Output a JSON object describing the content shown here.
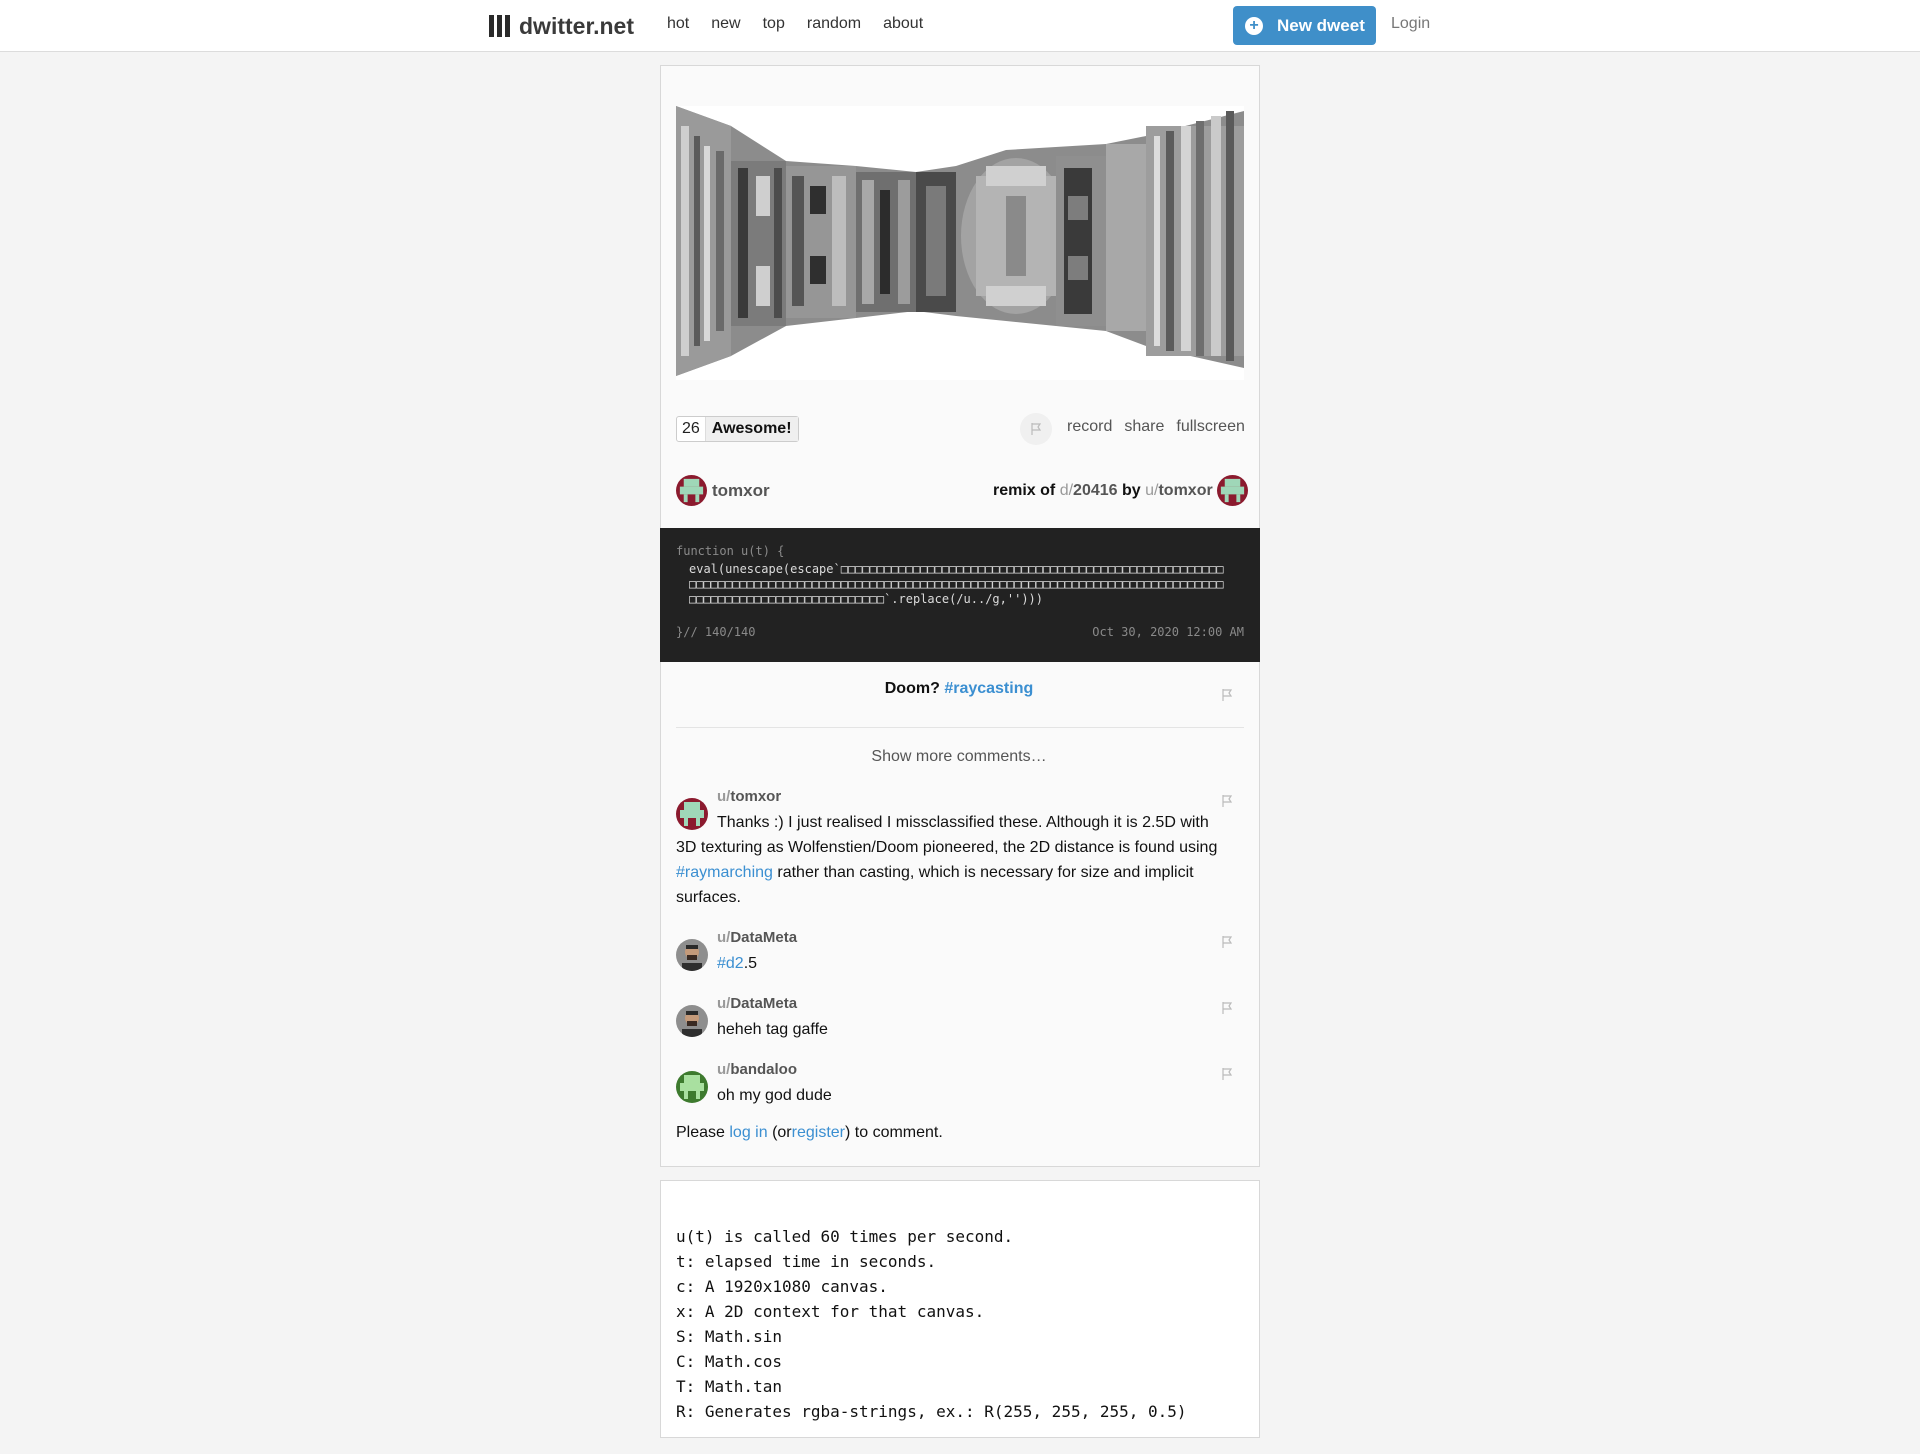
{
  "brand": {
    "name": "dwitter.net"
  },
  "nav": {
    "items": [
      "hot",
      "new",
      "top",
      "random",
      "about"
    ]
  },
  "header": {
    "new_dweet": "New dweet",
    "login": "Login"
  },
  "dweet": {
    "votes": "26",
    "awesome_label": "Awesome!",
    "actions": [
      "record",
      "share",
      "fullscreen"
    ],
    "author": "tomxor",
    "remix_label": "remix of",
    "remix_prefix": "d/",
    "remix_id": "20416",
    "remix_by": "by",
    "remix_user_prefix": "u/",
    "remix_user": "tomxor",
    "code_line1": "function u(t) {",
    "code_body": "eval(unescape(escape`□□□□□□□□□□□□□□□□□□□□□□□□□□□□□□□□□□□□□□□□□□□□□□□□□□□□□□□□□□□□□□□□□□□□□□□□□□□□□□□□□□□□□□□□□□□□□□□□□□□□□□□□□□□□□□□□□□□□□□□□□□□□□□□□□□□□□□□□□□□□□□□□□□□□□□□□□□`.replace(/u../g,'')))",
    "code_end": "}// 140/140",
    "date": "Oct 30, 2020 12:00 AM",
    "description_text": "Doom?",
    "description_tag": "#raycasting"
  },
  "comments": {
    "show_more": "Show more comments…",
    "items": [
      {
        "prefix": "u/",
        "user": "tomxor",
        "text_before": "Thanks :) I just realised I missclassified these. Although it is 2.5D with 3D texturing as Wolfenstien/Doom pioneered, the 2D distance is found using ",
        "tag": "#raymarching",
        "text_after": " rather than casting, which is necessary for size and implicit surfaces."
      },
      {
        "prefix": "u/",
        "user": "DataMeta",
        "tag": "#d2",
        "text_after": ".5"
      },
      {
        "prefix": "u/",
        "user": "DataMeta",
        "text": "heheh tag gaffe"
      },
      {
        "prefix": "u/",
        "user": "bandaloo",
        "text": "oh my god dude"
      }
    ],
    "please": "Please",
    "log_in": "log in",
    "or": "(or",
    "register": "register",
    "to_comment": ") to comment."
  },
  "help": {
    "lines": [
      "u(t) is called 60 times per second.",
      "t: elapsed time in seconds.",
      "c: A 1920x1080 canvas.",
      "x: A 2D context for that canvas.",
      "S: Math.sin",
      "C: Math.cos",
      "T: Math.tan",
      "R: Generates rgba-strings, ex.: R(255, 255, 255, 0.5)"
    ]
  },
  "colors": {
    "accent": "#3f8fc9",
    "link": "#3b8fd1",
    "code_bg": "#222222"
  },
  "icons": [
    "menu-bars-icon",
    "plus-circle-icon",
    "flag-icon"
  ]
}
